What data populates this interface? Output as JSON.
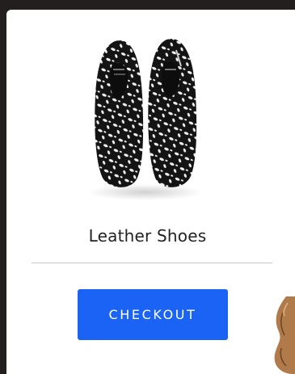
{
  "product": {
    "name": "Leather Shoes",
    "image_icon": "patterned-shoes-image"
  },
  "actions": {
    "checkout_label": "CHECKOUT"
  },
  "colors": {
    "background": "#231f1e",
    "card": "#ffffff",
    "accent": "#1a63f5",
    "divider": "#c9c9da"
  }
}
